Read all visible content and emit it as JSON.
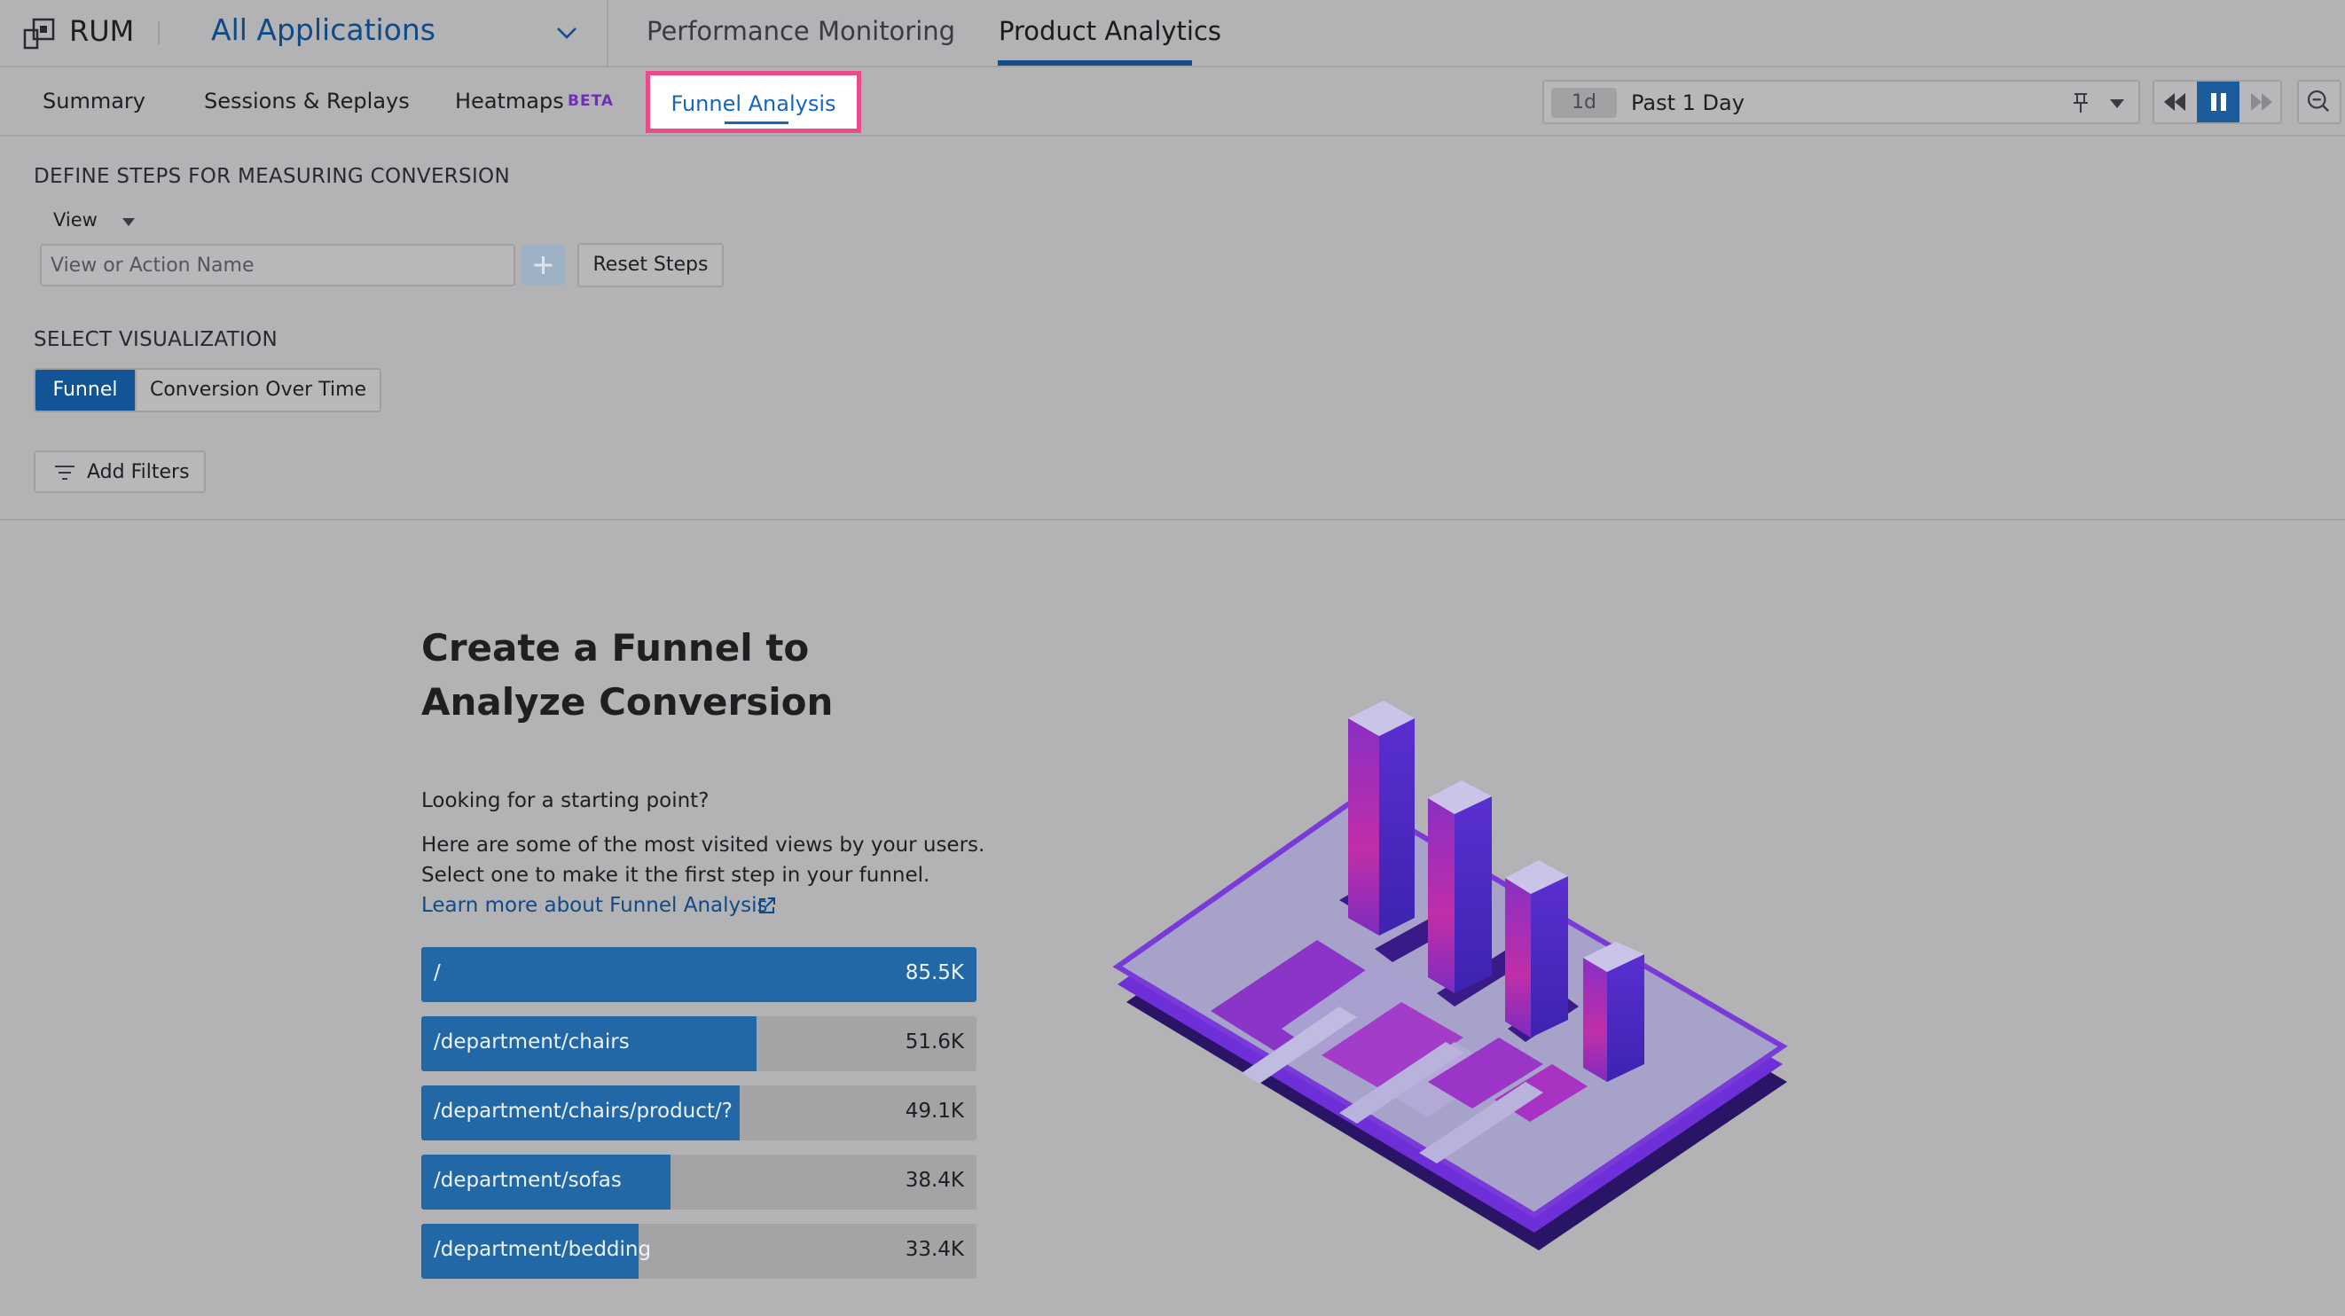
{
  "topnav": {
    "product": "RUM",
    "app_selector": "All Applications",
    "tabs": [
      "Performance Monitoring",
      "Product Analytics"
    ],
    "active_tab": "Product Analytics"
  },
  "subnav": {
    "tabs": [
      "Summary",
      "Sessions & Replays",
      "Heatmaps",
      "Funnel Analysis"
    ],
    "heatmaps_badge": "BETA",
    "active_tab": "Funnel Analysis",
    "active_highlight_color": "#ec4a8b"
  },
  "time_picker": {
    "badge": "1d",
    "label": "Past 1 Day"
  },
  "define_steps": {
    "heading": "DEFINE STEPS FOR MEASURING CONVERSION",
    "type_select": "View",
    "input_placeholder": "View or Action Name",
    "reset_label": "Reset Steps"
  },
  "visualization": {
    "heading": "SELECT VISUALIZATION",
    "options": [
      "Funnel",
      "Conversion Over Time"
    ],
    "selected": "Funnel"
  },
  "filters": {
    "label": "Add Filters"
  },
  "empty_state": {
    "title": "Create a Funnel to Analyze Conversion",
    "prompt": "Looking for a starting point?",
    "line1": "Here are some of the most visited views by your users.",
    "line2": "Select one to make it the first step in your funnel.",
    "link": "Learn more about Funnel Analysis",
    "views": [
      {
        "name": "/",
        "count": "85.5K",
        "value": 85500
      },
      {
        "name": "/department/chairs",
        "count": "51.6K",
        "value": 51600
      },
      {
        "name": "/department/chairs/product/?",
        "count": "49.1K",
        "value": 49100
      },
      {
        "name": "/department/sofas",
        "count": "38.4K",
        "value": 38400
      },
      {
        "name": "/department/bedding",
        "count": "33.4K",
        "value": 33400
      }
    ]
  },
  "colors": {
    "accent": "#125496",
    "link": "#0f4a86",
    "bar_fill": "#2268a6",
    "beta": "#6d2fb4"
  }
}
